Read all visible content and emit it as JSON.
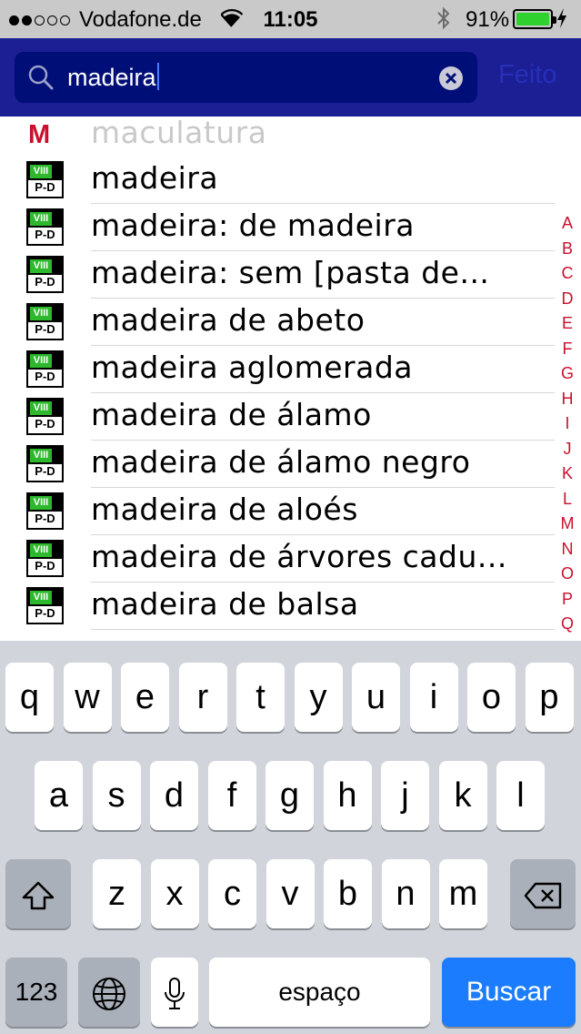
{
  "status": {
    "carrier": "Vodafone.de",
    "time": "11:05",
    "battery_pct": "91%",
    "icons": [
      "signal-dots",
      "wifi-icon",
      "bluetooth-icon",
      "battery-icon",
      "charging-bolt-icon"
    ]
  },
  "search": {
    "query": "madeira",
    "done_label": "Feito",
    "icons": [
      "search-icon",
      "clear-icon"
    ]
  },
  "list": {
    "partial_letter": "M",
    "partial_row": "maculatura",
    "badge_top": "VIII",
    "badge_bottom": "P-D",
    "items": [
      "madeira",
      "madeira: de madeira",
      "madeira: sem [pasta de...",
      "madeira de abeto",
      "madeira aglomerada",
      "madeira de álamo",
      "madeira de álamo negro",
      "madeira de aloés",
      "madeira de árvores cadu...",
      "madeira de balsa"
    ]
  },
  "index_letters": [
    "A",
    "B",
    "C",
    "D",
    "E",
    "F",
    "G",
    "H",
    "I",
    "J",
    "K",
    "L",
    "M",
    "N",
    "O",
    "P",
    "Q"
  ],
  "keyboard": {
    "row1": [
      "q",
      "w",
      "e",
      "r",
      "t",
      "y",
      "u",
      "i",
      "o",
      "p"
    ],
    "row2": [
      "a",
      "s",
      "d",
      "f",
      "g",
      "h",
      "j",
      "k",
      "l"
    ],
    "row3": [
      "z",
      "x",
      "c",
      "v",
      "b",
      "n",
      "m"
    ],
    "numbers_label": "123",
    "space_label": "espaço",
    "search_label": "Buscar",
    "icons": [
      "shift-icon",
      "backspace-icon",
      "globe-icon",
      "microphone-icon"
    ]
  },
  "colors": {
    "header_bg": "#1c1e94",
    "search_field_bg": "#000e78",
    "index_red": "#c8102e",
    "badge_green": "#2eb82e",
    "search_key_blue": "#1b7cfe"
  }
}
